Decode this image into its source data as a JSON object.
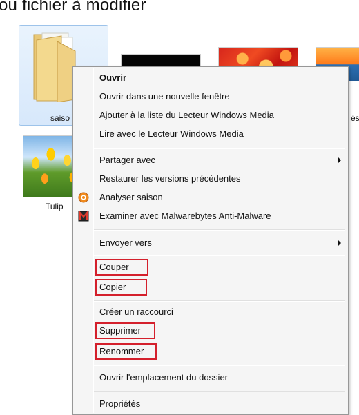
{
  "heading": "ou fichier à modifier",
  "items": {
    "folder_label": "saiso",
    "tulips_label": "Tulip",
    "right_label": "és"
  },
  "menu": {
    "items": [
      {
        "label": "Ouvrir",
        "bold": true
      },
      {
        "label": "Ouvrir dans une nouvelle fenêtre"
      },
      {
        "label": "Ajouter à la liste du Lecteur Windows Media"
      },
      {
        "label": "Lire avec le Lecteur Windows Media"
      },
      {
        "label": "Partager avec",
        "submenu": true
      },
      {
        "label": "Restaurer les versions précédentes"
      },
      {
        "label": "Analyser saison",
        "icon": "antivirus-icon"
      },
      {
        "label": "Examiner avec Malwarebytes Anti-Malware",
        "icon": "malwarebytes-icon"
      },
      {
        "label": "Envoyer vers",
        "submenu": true
      },
      {
        "label": "Couper",
        "highlighted": true
      },
      {
        "label": "Copier",
        "highlighted": true
      },
      {
        "label": "Créer un raccourci"
      },
      {
        "label": "Supprimer",
        "highlighted": true
      },
      {
        "label": "Renommer",
        "highlighted": true
      },
      {
        "label": "Ouvrir l'emplacement du dossier"
      },
      {
        "label": "Propriétés"
      }
    ],
    "highlight_color": "#d4202c"
  }
}
